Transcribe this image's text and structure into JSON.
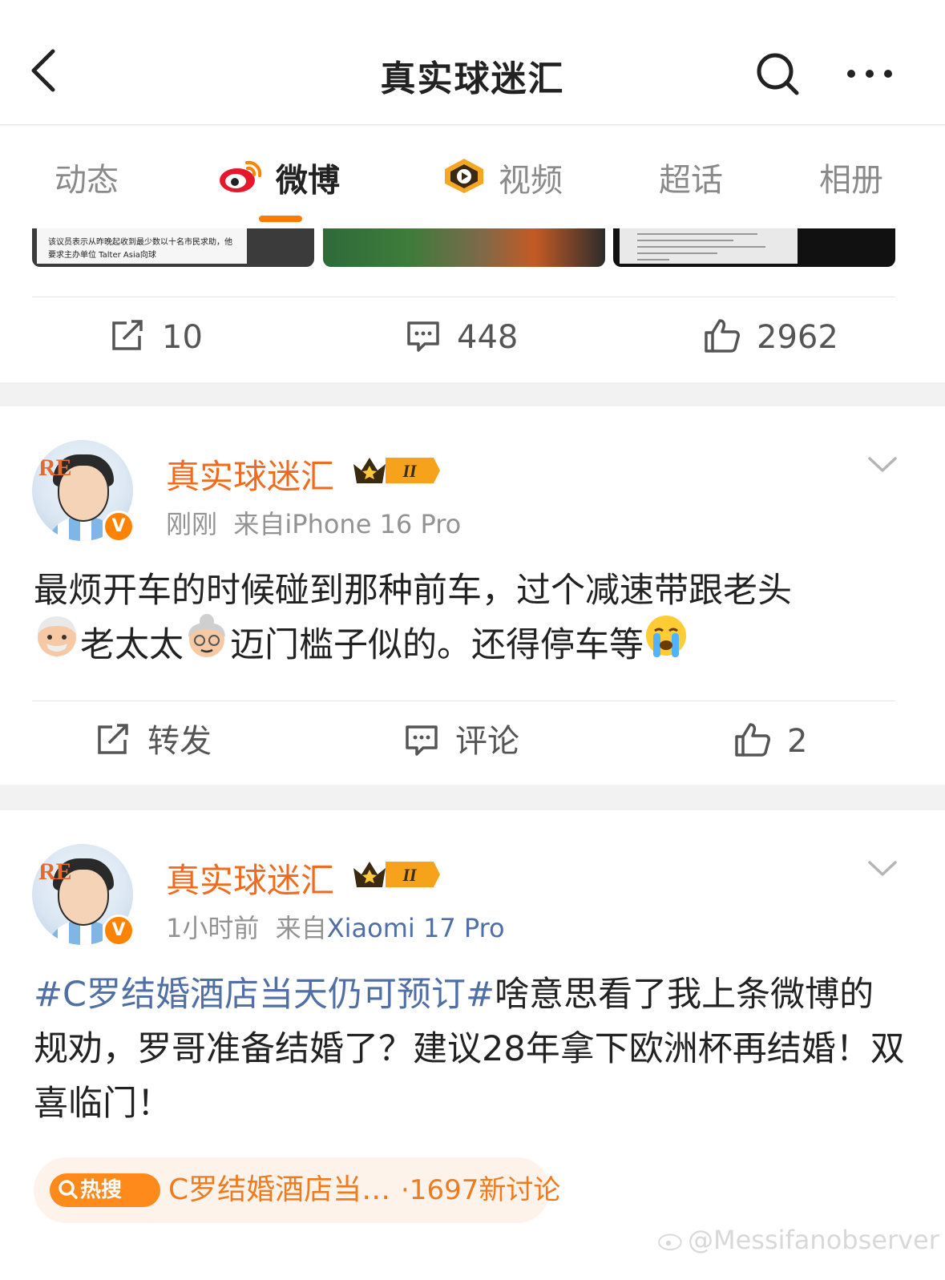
{
  "header": {
    "title": "真实球迷汇"
  },
  "tabs": [
    {
      "label": "动态"
    },
    {
      "label": "微博"
    },
    {
      "label": "视频"
    },
    {
      "label": "超话"
    },
    {
      "label": "相册"
    }
  ],
  "active_tab": "微博",
  "prev_post": {
    "thumb_caption": "该议员表示从昨晚起收到最少数以十名市民求助，他要求主办单位 Talter Asia向球",
    "repost_count": "10",
    "comment_count": "448",
    "like_count": "2962"
  },
  "posts": [
    {
      "author": "真实球迷汇",
      "time": "刚刚",
      "source_prefix": "来自",
      "source": "iPhone 16 Pro",
      "text_parts": {
        "a": "最烦开车的时候碰到那种前车，过个减速带跟老头",
        "b": "老太太",
        "c": "迈门槛子似的。还得停车等"
      },
      "emojis": [
        "old-man-emoji",
        "old-woman-emoji",
        "crying-emoji"
      ],
      "repost_label": "转发",
      "comment_label": "评论",
      "like_count": "2"
    },
    {
      "author": "真实球迷汇",
      "time": "1小时前",
      "source_prefix": "来自",
      "source": "Xiaomi 17 Pro",
      "topic": "#C罗结婚酒店当天仍可预订#",
      "text": "啥意思看了我上条微博的规劝，罗哥准备结婚了？建议28年拿下欧洲杯再结婚！双喜临门！",
      "hot_search": {
        "tag": "热搜",
        "title": "C罗结婚酒店当…",
        "count": "·1697新讨论"
      }
    }
  ],
  "badges": {
    "vip_level": "II",
    "verified": "V"
  },
  "watermark": "@Messifanobserver",
  "colors": {
    "accent": "#ff7a00",
    "username": "#f06b1d",
    "topic_link": "#4f6fa6",
    "hot_pill_bg": "#fdf3ea"
  }
}
